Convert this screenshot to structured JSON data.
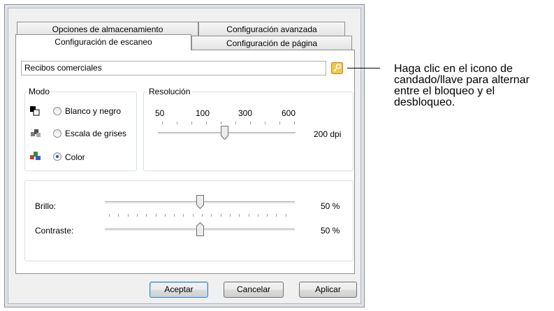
{
  "tabs": {
    "row_back": [
      "Opciones de almacenamiento",
      "Configuración avanzada"
    ],
    "row_front": [
      "Configuración de escaneo",
      "Configuración de página"
    ]
  },
  "profile": {
    "value": "Recibos comerciales"
  },
  "mode": {
    "label": "Modo",
    "options": [
      {
        "label": "Blanco y negro",
        "selected": false,
        "icon": "bw-scan-icon"
      },
      {
        "label": "Escala de grises",
        "selected": false,
        "icon": "grayscale-scan-icon"
      },
      {
        "label": "Color",
        "selected": true,
        "icon": "color-scan-icon"
      }
    ]
  },
  "resolution": {
    "label": "Resolución",
    "ticks": [
      "50",
      "100",
      "300",
      "600"
    ],
    "value_text": "200 dpi",
    "level": 0.5
  },
  "adjust": {
    "brightness": {
      "label": "Brillo:",
      "value_text": "50 %",
      "level": 0.5
    },
    "contrast": {
      "label": "Contraste:",
      "value_text": "50 %",
      "level": 0.5
    }
  },
  "buttons": {
    "ok": "Aceptar",
    "cancel": "Cancelar",
    "apply": "Aplicar"
  },
  "callout": {
    "text": "Haga clic en el icono de candado/llave para alternar entre el bloqueo y el desbloqueo."
  },
  "colors": {
    "accent": "#1a57b8",
    "lock": "#f2b233"
  }
}
